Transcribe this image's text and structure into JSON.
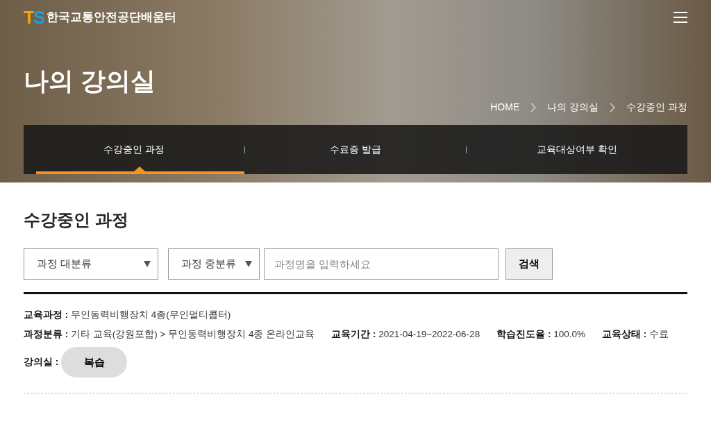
{
  "header": {
    "logo": "TS",
    "site_name": "한국교통안전공단배움터"
  },
  "page_title": "나의 강의실",
  "breadcrumb": [
    "HOME",
    "나의 강의실",
    "수강중인 과정"
  ],
  "tabs": [
    {
      "label": "수강중인 과정",
      "selected": true
    },
    {
      "label": "수료증 발급",
      "selected": false
    },
    {
      "label": "교육대상여부 확인",
      "selected": false
    }
  ],
  "section_title": "수강중인 과정",
  "search": {
    "category_major": "과정 대분류",
    "category_middle": "과정 중분류",
    "placeholder": "과정명을 입력하세요",
    "button": "검색"
  },
  "course": {
    "lines": [
      [
        {
          "label": "교육과정 :",
          "value": "무인동력비행장치 4종(무인멀티콥터)"
        }
      ],
      [
        {
          "label": "과정분류 :",
          "value": "기타 교육(강원포함) > 무인동력비행장치 4종 온라인교육"
        },
        {
          "label": "교육기간 :",
          "value": "2021-04-19~2022-06-28"
        },
        {
          "label": "학습진도율 :",
          "value": "100.0%"
        },
        {
          "label": "교육상태 :",
          "value": "수료"
        }
      ]
    ],
    "classroom_label": "강의실 :",
    "review_button": "복습"
  }
}
